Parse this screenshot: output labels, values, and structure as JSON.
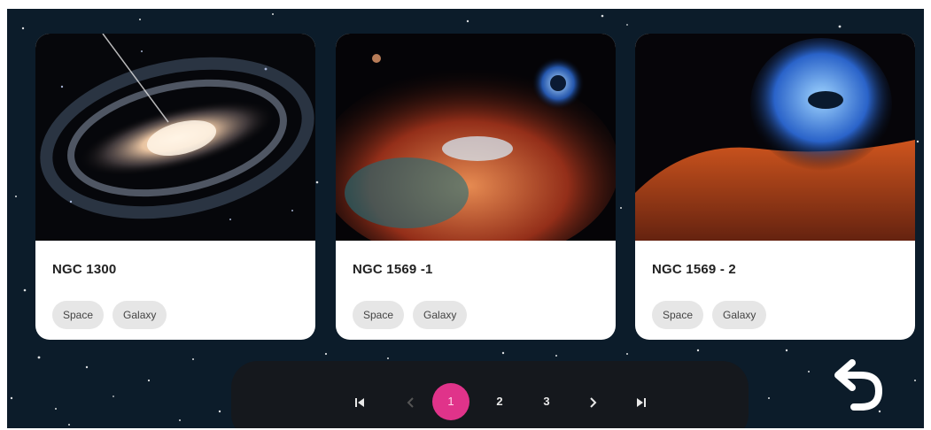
{
  "cards": [
    {
      "title": "NGC 1300",
      "tags": [
        "Space",
        "Galaxy"
      ]
    },
    {
      "title": "NGC 1569 -1",
      "tags": [
        "Space",
        "Galaxy"
      ]
    },
    {
      "title": "NGC 1569 - 2",
      "tags": [
        "Space",
        "Galaxy"
      ]
    }
  ],
  "pagination": {
    "first_icon": "skip-first-icon",
    "prev_icon": "chevron-left-icon",
    "pages": [
      "1",
      "2",
      "3"
    ],
    "current_page": "1",
    "next_icon": "chevron-right-icon",
    "last_icon": "skip-last-icon"
  },
  "back_icon": "undo-arrow-icon",
  "colors": {
    "background": "#0c1c2a",
    "active_page": "#e0338a",
    "pager_bar": "#15181d"
  }
}
